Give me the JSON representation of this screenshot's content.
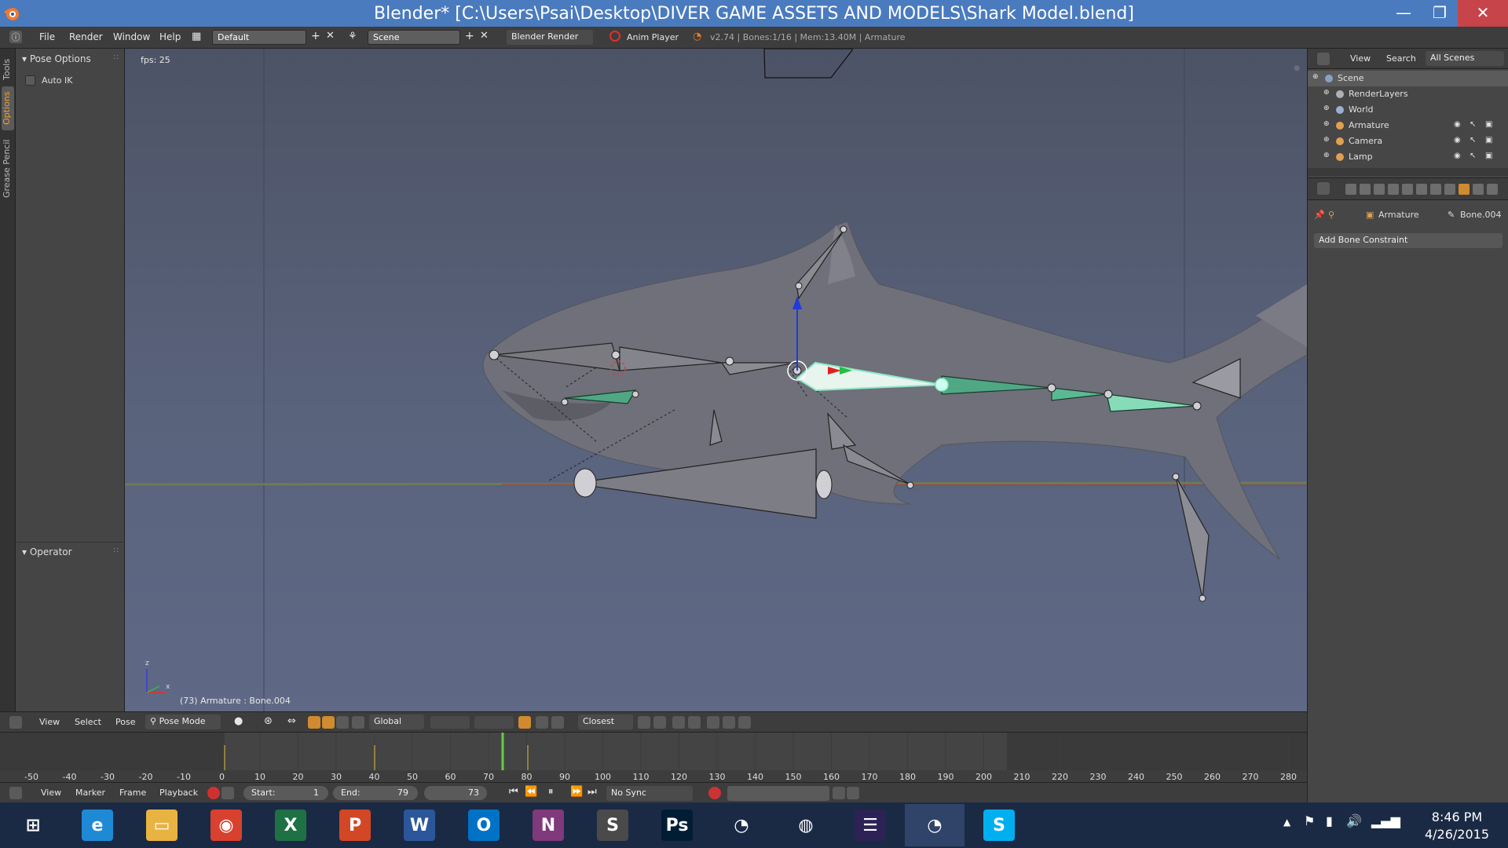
{
  "window": {
    "title": "Blender* [C:\\Users\\Psai\\Desktop\\DIVER GAME ASSETS AND MODELS\\Shark Model.blend]",
    "minimize_glyph": "—",
    "maximize_glyph": "❐",
    "close_glyph": "✕"
  },
  "menubar": {
    "menus": [
      "File",
      "Render",
      "Window",
      "Help"
    ],
    "screen_layout": "Default",
    "scene": "Scene",
    "render_engine": "Blender Render",
    "anim_player": "Anim Player",
    "stats": "v2.74 | Bones:1/16 | Mem:13.40M | Armature"
  },
  "tabs": [
    "Tools",
    "Options",
    "Grease Pencil"
  ],
  "toolshelf": {
    "pose_options_title": "Pose Options",
    "auto_ik_label": "Auto IK",
    "operator_title": "Operator"
  },
  "viewport": {
    "fps": "fps: 25",
    "object_info": "(73) Armature : Bone.004",
    "axis_x": "x",
    "axis_z": "z"
  },
  "viewport_header": {
    "menus": [
      "View",
      "Select",
      "Pose"
    ],
    "mode": "Pose Mode",
    "orientation": "Global",
    "snap": "Closest"
  },
  "timeline": {
    "ruler": [
      "-50",
      "-40",
      "-30",
      "-20",
      "-10",
      "0",
      "10",
      "20",
      "30",
      "40",
      "50",
      "60",
      "70",
      "80",
      "90",
      "100",
      "110",
      "120",
      "130",
      "140",
      "150",
      "160",
      "170",
      "180",
      "190",
      "200",
      "210",
      "220",
      "230",
      "240",
      "250",
      "260",
      "270",
      "280"
    ],
    "menus": [
      "View",
      "Marker",
      "Frame",
      "Playback"
    ],
    "start_label": "Start:",
    "start_value": "1",
    "end_label": "End:",
    "end_value": "79",
    "current_frame": "73",
    "sync": "No Sync"
  },
  "outliner": {
    "header": [
      "View",
      "Search",
      "All Scenes"
    ],
    "rows": [
      {
        "name": "Scene",
        "indent": 0,
        "color": "#8aa0c8"
      },
      {
        "name": "RenderLayers",
        "indent": 1,
        "color": "#b0b0b0"
      },
      {
        "name": "World",
        "indent": 1,
        "color": "#9ab0d0"
      },
      {
        "name": "Armature",
        "indent": 1,
        "color": "#e0a050"
      },
      {
        "name": "Camera",
        "indent": 1,
        "color": "#e0a050"
      },
      {
        "name": "Lamp",
        "indent": 1,
        "color": "#e0a050"
      }
    ]
  },
  "properties": {
    "breadcrumb_object": "Armature",
    "breadcrumb_bone": "Bone.004",
    "add_constraint": "Add Bone Constraint"
  },
  "taskbar": {
    "apps": [
      {
        "name": "windows-start",
        "glyph": "⊞",
        "bg": "#1b2a44"
      },
      {
        "name": "internet-explorer",
        "glyph": "e",
        "bg": "#1e8ad6"
      },
      {
        "name": "file-explorer",
        "glyph": "▭",
        "bg": "#e9b342"
      },
      {
        "name": "chrome",
        "glyph": "◉",
        "bg": "#d9412f"
      },
      {
        "name": "excel",
        "glyph": "X",
        "bg": "#1e7145"
      },
      {
        "name": "powerpoint",
        "glyph": "P",
        "bg": "#d24726"
      },
      {
        "name": "word",
        "glyph": "W",
        "bg": "#2b579a"
      },
      {
        "name": "outlook",
        "glyph": "O",
        "bg": "#0072c6"
      },
      {
        "name": "onenote",
        "glyph": "N",
        "bg": "#80397b"
      },
      {
        "name": "sublime-text",
        "glyph": "S",
        "bg": "#4a4a4a"
      },
      {
        "name": "photoshop",
        "glyph": "Ps",
        "bg": "#001d34"
      },
      {
        "name": "blender",
        "glyph": "◔",
        "bg": "#1b2a44"
      },
      {
        "name": "paint-app",
        "glyph": "◍",
        "bg": "#1b2a44"
      },
      {
        "name": "eclipse",
        "glyph": "☰",
        "bg": "#2c2255"
      },
      {
        "name": "blender-active",
        "glyph": "◔",
        "bg": "#2f4468"
      },
      {
        "name": "skype",
        "glyph": "S",
        "bg": "#00aff0"
      }
    ],
    "time": "8:46 PM",
    "date": "4/26/2015"
  },
  "colors": {
    "titlebar": "#4a7bbf",
    "selected_bone": "#8fe8c8",
    "posebone_green": "#4fa883",
    "accent_orange": "#f0a030"
  }
}
